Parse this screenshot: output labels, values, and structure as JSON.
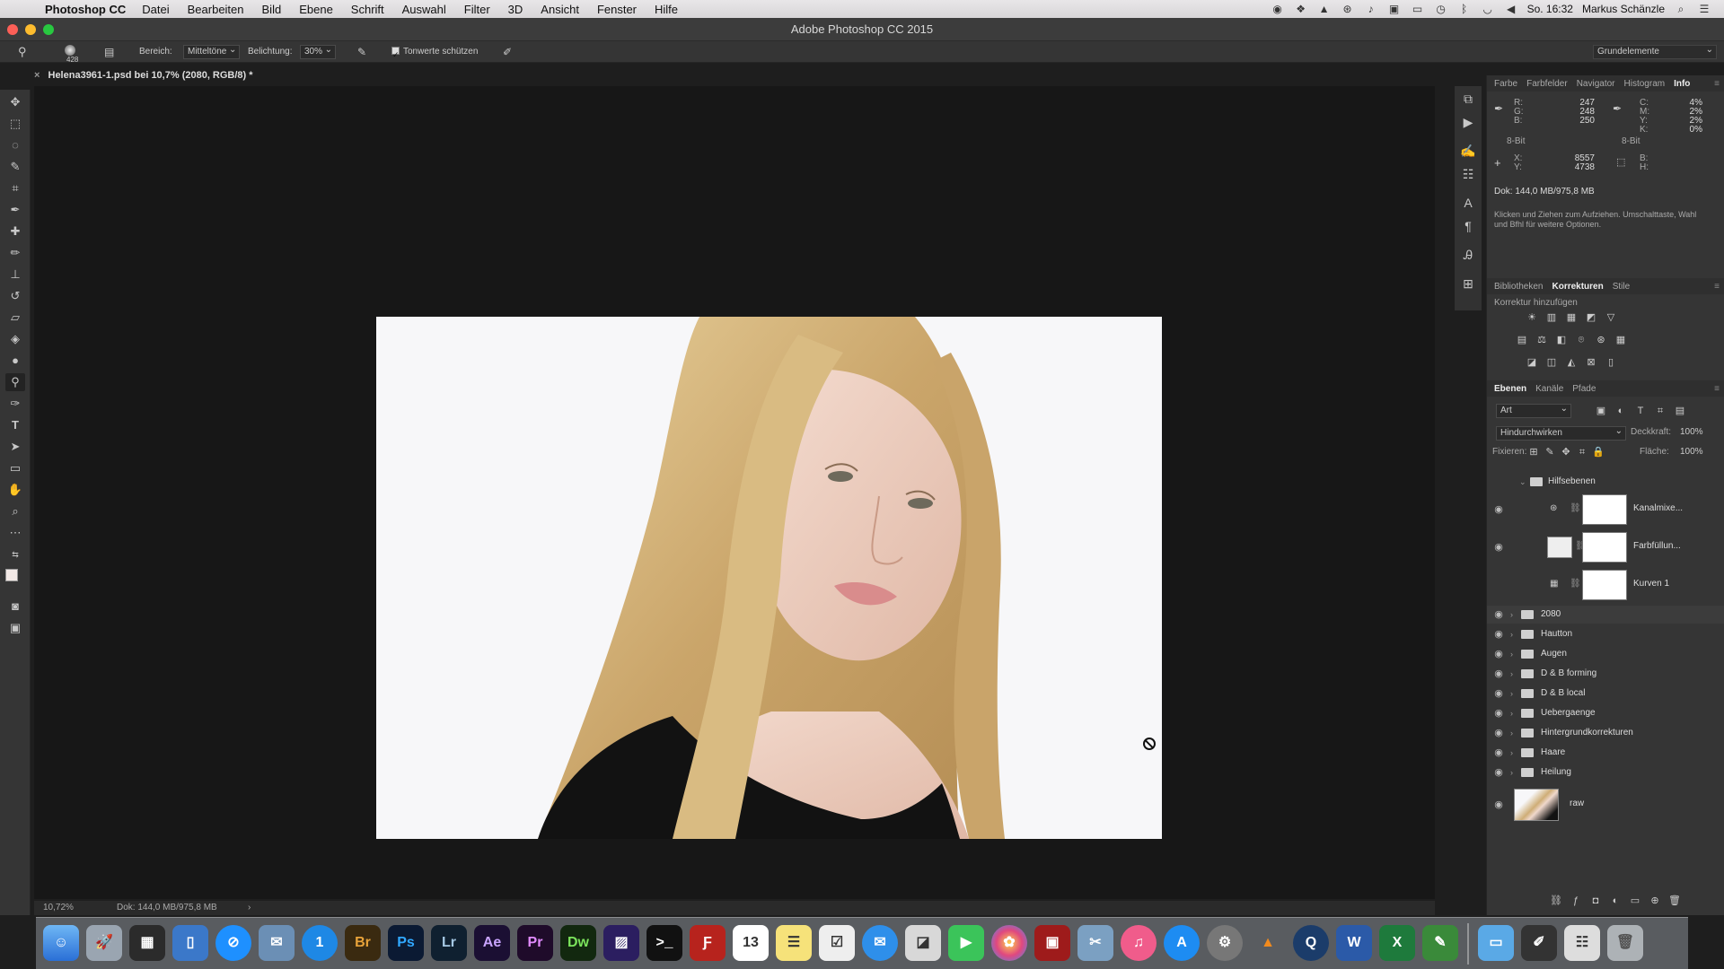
{
  "menubar": {
    "app_name": "Photoshop CC",
    "items": [
      "Datei",
      "Bearbeiten",
      "Bild",
      "Ebene",
      "Schrift",
      "Auswahl",
      "Filter",
      "3D",
      "Ansicht",
      "Fenster",
      "Hilfe"
    ],
    "clock": "So. 16:32",
    "user": "Markus Schänzle"
  },
  "titlebar": {
    "title": "Adobe Photoshop CC 2015"
  },
  "options": {
    "brush_size": "428",
    "range_label": "Bereich:",
    "range_value": "Mitteltöne",
    "exposure_label": "Belichtung:",
    "exposure_value": "30%",
    "protect_tones": "Tonwerte schützen",
    "workspace": "Grundelemente"
  },
  "document": {
    "tab_title": "Helena3961-1.psd bei 10,7% (2080, RGB/8) *",
    "zoom": "10,72%",
    "doc_size": "Dok: 144,0 MB/975,8 MB"
  },
  "info_panel": {
    "tabs": [
      "Farbe",
      "Farbfelder",
      "Navigator",
      "Histogram",
      "Info"
    ],
    "active_tab": "Info",
    "rgb_labels": [
      "R:",
      "G:",
      "B:"
    ],
    "rgb_values": [
      "247",
      "248",
      "250"
    ],
    "cmyk_labels": [
      "C:",
      "M:",
      "Y:",
      "K:"
    ],
    "cmyk_values": [
      "4%",
      "2%",
      "2%",
      "0%"
    ],
    "bit_left": "8-Bit",
    "bit_right": "8-Bit",
    "xy_labels": [
      "X:",
      "Y:"
    ],
    "xy_values": [
      "8557",
      "4738"
    ],
    "bh_labels": [
      "B:",
      "H:"
    ],
    "doc_size": "Dok: 144,0 MB/975,8 MB",
    "hint": "Klicken und Ziehen zum Aufziehen. Umschalttaste, Wahl und Bfhl für weitere Optionen."
  },
  "adjust_panel": {
    "tabs": [
      "Bibliotheken",
      "Korrekturen",
      "Stile"
    ],
    "active_tab": "Korrekturen",
    "heading": "Korrektur hinzufügen"
  },
  "layers_panel": {
    "tabs": [
      "Ebenen",
      "Kanäle",
      "Pfade"
    ],
    "active_tab": "Ebenen",
    "filter": "Art",
    "blend_mode": "Hindurchwirken",
    "opacity_label": "Deckkraft:",
    "opacity_value": "100%",
    "lock_label": "Fixieren:",
    "fill_label": "Fläche:",
    "fill_value": "100%",
    "group_open": "Hilfsebenen",
    "adjustment_layers": [
      "Kanalmixe...",
      "Farbfüllun...",
      "Kurven 1"
    ],
    "groups": [
      "2080",
      "Hautton",
      "Augen",
      "D & B forming",
      "D & B local",
      "Uebergaenge",
      "Hintergrundkorrekturen",
      "Haare",
      "Heilung"
    ],
    "raw_layer": "raw"
  },
  "dock": {
    "apps": [
      "Ps",
      "Br",
      "Lr",
      "Ae",
      "Pr",
      "Dw",
      "Word",
      "Excel"
    ],
    "labels": {
      "br": "Br",
      "ps": "Ps",
      "lr": "Lr",
      "ae": "Ae",
      "pr": "Pr",
      "dw": "Dw",
      "word": "W",
      "excel": "X",
      "calendar_day": "13"
    }
  },
  "colors": {
    "photoshop_blue": "#31a8ff",
    "panel_bg": "#353535",
    "canvas_bg": "#171717"
  }
}
